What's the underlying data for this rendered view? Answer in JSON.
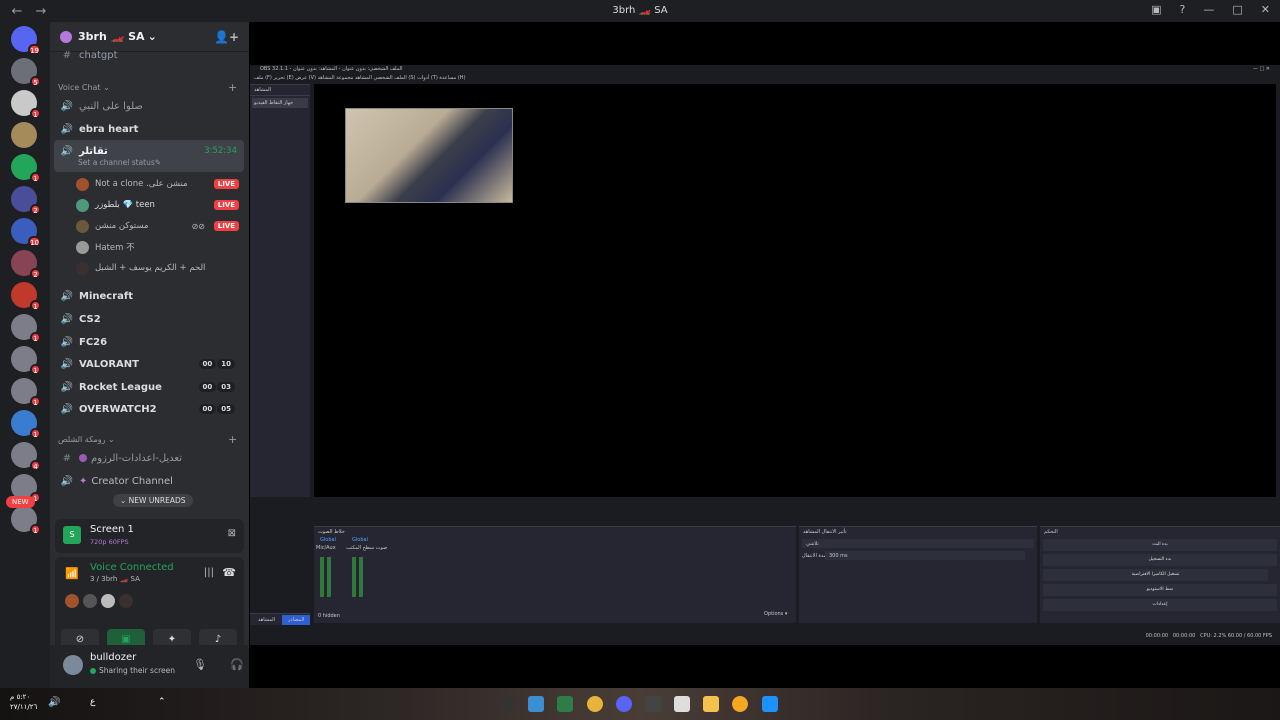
{
  "titlebar": {
    "title": "3brh 🏎️ SA"
  },
  "guild": {
    "name": "3brh 🏎️ SA"
  },
  "server_badges": [
    "19",
    "5",
    "1",
    "",
    "1",
    "2",
    "10",
    "2",
    "1",
    "1",
    "1",
    "1",
    "1",
    "4",
    "1",
    "1"
  ],
  "new_label": "NEW",
  "channels": {
    "top_text": "chatgpt",
    "voice_category": "Voice Chat",
    "items": [
      {
        "label": "صلوا على النبي",
        "bold": false
      },
      {
        "label": "ebra heart",
        "bold": true
      },
      {
        "label": "تقاتلر",
        "bold": true,
        "timer": "3:52:34",
        "status": "Set a channel status"
      },
      {
        "label": "Minecraft",
        "bold": true
      },
      {
        "label": "CS2",
        "bold": true
      },
      {
        "label": "FC26",
        "bold": true
      },
      {
        "label": "VALORANT",
        "bold": true,
        "counts": [
          "00",
          "10"
        ]
      },
      {
        "label": "Rocket League",
        "bold": true,
        "counts": [
          "00",
          "03"
        ]
      },
      {
        "label": "OVERWATCH2",
        "bold": true,
        "counts": [
          "00",
          "05"
        ]
      }
    ],
    "members": [
      {
        "name": "Not a clone .منشن على",
        "live": "LIVE"
      },
      {
        "name": "بلطوزر 💎 teen",
        "live": "LIVE"
      },
      {
        "name": "مستوكن منشن",
        "live": "LIVE"
      },
      {
        "name": "Hatem 不",
        "live": ""
      },
      {
        "name": "الحم + الكريم يوسف + الشبل",
        "live": ""
      }
    ],
    "category2": "رومكة الشلص",
    "extra": [
      {
        "label": "تعديل-اعدادات-الرزوم"
      },
      {
        "label": "Creator Channel"
      }
    ],
    "new_unreads": "NEW UNREADS"
  },
  "screen_panel": {
    "title": "Screen 1",
    "sub": "720p 60FPS"
  },
  "voice_panel": {
    "status": "Voice Connected",
    "sub": "3 / 3brh 🏎️ SA"
  },
  "user_panel": {
    "name": "bulldozer",
    "status": "Sharing their screen"
  },
  "obs": {
    "title": "OBS 32.1.1 - الملف الشخصي: بدون عنوان - المشاهد: بدون عنوان",
    "menu": "ملف (F)   تحرير (E)   عرض (V)   الملف الشخصي   المشاهد   مجموعة المشاهد (S)   أدوات (T)   مساعدة (H)",
    "scene_header": "المشاهد",
    "scene_item": "جهاز التقاط الفيديو",
    "mixer_header": "خلاط الصوت",
    "ch1": "Global",
    "ch2": "Global",
    "ch1_label": "Mic/Aux",
    "ch2_label": "صوت سطح المكتب",
    "transitions_header": "تأثير الانتقال المشاهد",
    "transition_value": "تلاشي",
    "duration_label": "مدة الانتقال",
    "duration_value": "300 ms",
    "controls_header": "التحكم",
    "controls": [
      "بدء البث",
      "بدء التسجيل",
      "تشغيل الكاميرا الافتراضية",
      "نمط الاستوديو",
      "إعدادات"
    ],
    "hidden": "0 hidden",
    "options": "Options",
    "tab1": "المشاهد",
    "tab2": "المصادر",
    "status": "CPU: 2.2%   60.00 / 60.00 FPS",
    "status_time1": "00:00:00",
    "status_time2": "00:00:00"
  },
  "taskbar": {
    "time": "٥:٢٠ م",
    "date": "٢٧/١١/٢٦",
    "lang": "ع"
  }
}
